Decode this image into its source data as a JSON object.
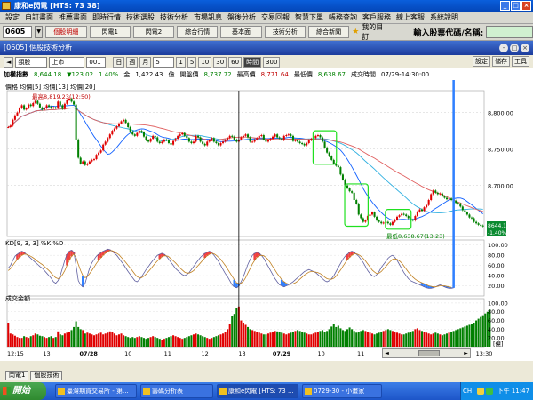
{
  "window": {
    "title": "康和e閃電 [HTS: 73 38]"
  },
  "menu": [
    "設定",
    "自訂畫面",
    "推薦畫面",
    "即時行情",
    "技術選股",
    "技術分析",
    "市場訊息",
    "盤後分析",
    "交易回報",
    "智慧下單",
    "帳務查詢",
    "客戶服務",
    "線上客服",
    "系統說明"
  ],
  "toolbar": {
    "stock_code": "0605",
    "buttons": [
      "個股明細",
      "閃電1",
      "閃電2",
      "綜合行情",
      "基本面",
      "技術分析",
      "綜合新聞"
    ],
    "my_page": "我的目訂",
    "code_label": "輸入股票代碼/名稱:"
  },
  "panel": {
    "title": "[0605] 個股技術分析"
  },
  "controls": {
    "type": "類股",
    "market": "上市",
    "index": "001",
    "period_buttons": [
      "日",
      "週",
      "月"
    ],
    "count": "5",
    "minute_buttons": [
      "1",
      "5",
      "10",
      "30",
      "60"
    ],
    "tick": "時間",
    "tick_value": "300",
    "right_buttons": [
      "設定",
      "儲存",
      "工具"
    ]
  },
  "info": {
    "name": "加權指數",
    "price": "8,644.18",
    "change": "▼123.02",
    "change_pct": "1.40%",
    "amount_label": "金",
    "amount": "1,422.43",
    "amount_unit": "億",
    "open_label": "開盤價",
    "open": "8,737.72",
    "high_label": "最高價",
    "high": "8,771.64",
    "low_label": "最低價",
    "low": "8,638.67",
    "time_label": "成交時間",
    "time": "07/29-14:30:00"
  },
  "chart_data": {
    "type": "candlestick",
    "price_panel": {
      "legend": "價格 均價[5] 均價[13] 均價[20]",
      "yticks": [
        "8,800.00",
        "8,750.00",
        "8,700.00"
      ],
      "high_annot": "最高8,819.23(12:50)",
      "low_annot": "最低8,638.67(13:23)",
      "last_price": "8644.18",
      "last_change": "-1.40%"
    },
    "kd_panel": {
      "legend": "KD[9, 3, 3]  %K  %D",
      "yticks": [
        "100.00",
        "80.00",
        "60.00",
        "40.00",
        "20.00"
      ]
    },
    "vol_panel": {
      "legend": "成交金額",
      "yticks": [
        "100.00",
        "80.00",
        "60.00",
        "40.00",
        "20.00"
      ],
      "unit": "[億]"
    },
    "x_labels": [
      "12:15",
      "13",
      "07/28",
      "10",
      "11",
      "12",
      "13",
      "07/29",
      "10",
      "11",
      "12",
      "13",
      "13:30"
    ],
    "prices": [
      8780,
      8782,
      8790,
      8796,
      8800,
      8806,
      8810,
      8804,
      8806,
      8811,
      8809,
      8813,
      8816,
      8812,
      8807,
      8804,
      8806,
      8810,
      8808,
      8806,
      8807,
      8806,
      8815,
      8810,
      8805,
      8812,
      8817,
      8819,
      8815,
      8811,
      8763,
      8738,
      8730,
      8733,
      8728,
      8730,
      8733,
      8735,
      8736,
      8742,
      8745,
      8748,
      8756,
      8760,
      8765,
      8770,
      8775,
      8778,
      8781,
      8785,
      8788,
      8790,
      8786,
      8780,
      8774,
      8770,
      8768,
      8772,
      8775,
      8773,
      8767,
      8762,
      8760,
      8764,
      8768,
      8766,
      8760,
      8758,
      8760,
      8763,
      8762,
      8758,
      8756,
      8761,
      8764,
      8768,
      8770,
      8772,
      8768,
      8765,
      8760,
      8758,
      8760,
      8768,
      8766,
      8760,
      8757,
      8755,
      8760,
      8762,
      8765,
      8760,
      8758,
      8755,
      8758,
      8760,
      8762,
      8765,
      8768,
      8767,
      8763,
      8760,
      8763,
      8766,
      8768,
      8770,
      8766,
      8760,
      8760,
      8763,
      8765,
      8768,
      8769,
      8763,
      8760,
      8762,
      8764,
      8767,
      8770,
      8766,
      8765,
      8762,
      8768,
      8769,
      8770,
      8768,
      8761,
      8762,
      8760,
      8758,
      8757,
      8755,
      8758,
      8762,
      8764,
      8765,
      8768,
      8769,
      8766,
      8760,
      8752,
      8745,
      8740,
      8735,
      8730,
      8727,
      8725,
      8715,
      8708,
      8700,
      8696,
      8692,
      8690,
      8680,
      8675,
      8660,
      8655,
      8650,
      8652,
      8658,
      8660,
      8663,
      8657,
      8652,
      8650,
      8648,
      8649,
      8650,
      8648,
      8646,
      8650,
      8653,
      8657,
      8659,
      8661,
      8660,
      8658,
      8655,
      8653,
      8652,
      8658,
      8664,
      8667,
      8665,
      8670,
      8673,
      8680,
      8688,
      8693,
      8690,
      8688,
      8689,
      8685,
      8683,
      8681,
      8682,
      8680,
      8679,
      8676,
      8675,
      8671,
      8666,
      8663,
      8660,
      8656,
      8655,
      8650,
      8648,
      8646,
      8645,
      8644
    ],
    "volumes": [
      55,
      30,
      28,
      25,
      22,
      20,
      20,
      24,
      22,
      20,
      24,
      26,
      30,
      28,
      25,
      24,
      22,
      20,
      22,
      24,
      20,
      22,
      35,
      28,
      26,
      30,
      32,
      34,
      38,
      45,
      58,
      45,
      40,
      38,
      30,
      32,
      30,
      28,
      26,
      28,
      30,
      32,
      28,
      30,
      32,
      35,
      34,
      30,
      26,
      28,
      30,
      26,
      24,
      22,
      20,
      22,
      20,
      22,
      24,
      22,
      20,
      18,
      20,
      22,
      24,
      22,
      20,
      18,
      16,
      18,
      20,
      22,
      24,
      26,
      24,
      22,
      20,
      18,
      20,
      22,
      24,
      26,
      28,
      30,
      28,
      26,
      24,
      22,
      20,
      18,
      20,
      22,
      24,
      26,
      28,
      30,
      34,
      40,
      52,
      70,
      75,
      88,
      92,
      60,
      55,
      50,
      45,
      40,
      38,
      36,
      34,
      32,
      30,
      28,
      28,
      30,
      32,
      34,
      36,
      35,
      34,
      32,
      30,
      28,
      30,
      32,
      34,
      36,
      38,
      36,
      34,
      32,
      30,
      28,
      28,
      30,
      32,
      34,
      36,
      38,
      34,
      36,
      40,
      46,
      52,
      45,
      48,
      42,
      38,
      36,
      40,
      44,
      40,
      36,
      32,
      34,
      36,
      38,
      36,
      34,
      32,
      30,
      28,
      30,
      32,
      34,
      36,
      38,
      40,
      38,
      36,
      34,
      32,
      30,
      28,
      28,
      30,
      32,
      34,
      36,
      40,
      42,
      38,
      36,
      34,
      32,
      30,
      28,
      30,
      32,
      30,
      28,
      26,
      28,
      30,
      32,
      34,
      36,
      38,
      40,
      42,
      44,
      46,
      48,
      50,
      52,
      55,
      60,
      64,
      68,
      72,
      76,
      80,
      85
    ],
    "k": [
      55,
      60,
      70,
      78,
      82,
      85,
      88,
      86,
      82,
      78,
      74,
      70,
      66,
      62,
      58,
      55,
      50,
      45,
      40,
      35,
      28,
      25,
      30,
      40,
      55,
      70,
      82,
      88,
      90,
      86,
      60,
      30,
      22,
      18,
      25,
      40,
      55,
      65,
      72,
      78,
      82,
      85,
      88,
      90,
      92,
      91,
      88,
      84,
      80,
      74,
      68,
      62,
      55,
      48,
      42,
      36,
      30,
      28,
      32,
      38,
      45,
      52,
      58,
      64,
      70,
      75,
      80,
      82,
      84,
      82,
      78,
      72,
      66,
      60,
      54,
      50,
      46,
      42,
      40,
      42,
      46,
      52,
      58,
      64,
      70,
      76,
      80,
      84,
      86,
      88,
      85,
      80,
      74,
      68,
      60,
      52,
      44,
      38,
      30,
      22,
      18,
      16,
      20,
      28,
      38,
      50,
      62,
      72,
      80,
      84,
      86,
      84,
      80,
      74,
      66,
      58,
      50,
      42,
      34,
      28,
      22,
      20,
      18,
      20,
      22,
      25,
      28,
      32,
      36,
      40,
      44,
      48,
      50,
      52,
      50,
      48,
      46,
      42,
      38,
      34,
      30,
      28,
      30,
      34,
      40,
      48,
      56,
      64,
      72,
      78,
      82,
      86,
      88,
      86,
      82,
      78,
      72,
      66,
      58,
      50,
      44,
      40,
      38,
      42,
      48,
      56,
      62,
      68,
      74,
      78,
      80,
      76,
      70,
      62,
      54,
      46,
      40,
      34,
      30,
      28,
      26,
      24,
      22,
      20,
      18,
      16,
      15,
      15,
      16,
      18,
      20,
      22,
      20,
      18,
      16,
      15,
      15,
      16
    ],
    "d": [
      50,
      54,
      60,
      66,
      72,
      76,
      80,
      82,
      82,
      80,
      78,
      75,
      72,
      68,
      65,
      62,
      58,
      54,
      50,
      45,
      40,
      36,
      34,
      36,
      42,
      50,
      60,
      70,
      78,
      82,
      76,
      62,
      50,
      40,
      36,
      38,
      44,
      50,
      57,
      64,
      70,
      75,
      80,
      84,
      87,
      89,
      89,
      87,
      84,
      81,
      76,
      71,
      66,
      60,
      55,
      49,
      43,
      38,
      36,
      36,
      39,
      43,
      48,
      53,
      59,
      64,
      69,
      73,
      77,
      79,
      79,
      77,
      73,
      69,
      65,
      60,
      55,
      51,
      47,
      45,
      45,
      47,
      50,
      55,
      60,
      65,
      70,
      75,
      79,
      82,
      84,
      83,
      80,
      76,
      72,
      66,
      60,
      53,
      46,
      39,
      32,
      26,
      24,
      25,
      29,
      36,
      45,
      54,
      63,
      70,
      76,
      79,
      80,
      79,
      76,
      71,
      65,
      58,
      51,
      44,
      38,
      32,
      28,
      25,
      23,
      23,
      24,
      26,
      29,
      33,
      37,
      41,
      44,
      47,
      48,
      48,
      47,
      46,
      44,
      41,
      37,
      34,
      33,
      33,
      35,
      39,
      45,
      51,
      58,
      65,
      71,
      76,
      80,
      83,
      83,
      81,
      78,
      74,
      69,
      63,
      57,
      51,
      47,
      44,
      45,
      48,
      53,
      58,
      63,
      68,
      72,
      73,
      72,
      69,
      65,
      59,
      53,
      47,
      42,
      37,
      33,
      30,
      28,
      26,
      24,
      22,
      20,
      19,
      18,
      18,
      19,
      20,
      20,
      20,
      19,
      18,
      17
    ]
  },
  "chart_windows": [
    "閃電1",
    "個股技術"
  ],
  "taskbar": {
    "start": "開始",
    "tasks": [
      "臺灣期貨交易所 - 第...",
      "籌碼分析表",
      "康和e閃電 [HTS: 73 ...",
      "0729-30 - 小畫家"
    ],
    "lang": "CH",
    "clock": "下午 11:47"
  }
}
